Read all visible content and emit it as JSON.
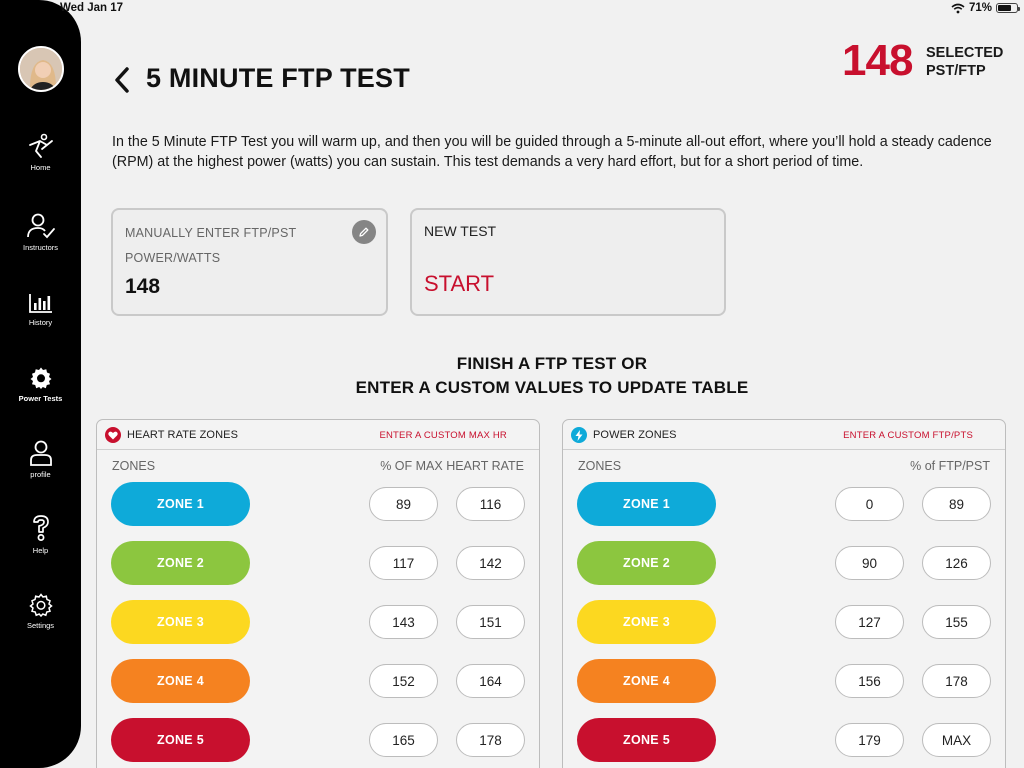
{
  "status_bar": {
    "time": "Wed Jan 17",
    "battery": "71%",
    "battery_level": 0.71
  },
  "sidebar": {
    "items": [
      {
        "label": "Home",
        "icon": "rider-icon"
      },
      {
        "label": "Instructors",
        "icon": "instructor-icon"
      },
      {
        "label": "History",
        "icon": "chart-icon"
      },
      {
        "label": "Power Tests",
        "icon": "gear-icon"
      },
      {
        "label": "profile",
        "icon": "person-icon"
      },
      {
        "label": "Help",
        "icon": "question-icon"
      },
      {
        "label": "Settings",
        "icon": "settings-icon"
      }
    ]
  },
  "header": {
    "title": "5 MINUTE FTP TEST",
    "selected_value": "148",
    "selected_label_1": "SELECTED",
    "selected_label_2": "PST/FTP"
  },
  "description": "In the 5 Minute FTP Test you will warm up, and then you will be guided through a 5-minute all-out effort, where you’ll hold a steady cadence (RPM) at the highest power (watts) you can sustain. This test demands a very hard effort, but for a short period of time.",
  "manual_card": {
    "label_1": "MANUALLY ENTER FTP/PST",
    "label_2": "POWER/WATTS",
    "value": "148"
  },
  "new_test_card": {
    "label": "NEW TEST",
    "start": "START"
  },
  "finish_text_1": "FINISH A FTP TEST OR",
  "finish_text_2": "ENTER A CUSTOM VALUES TO UPDATE TABLE",
  "colors": {
    "accent": "#c8102e",
    "zone1": "#0eaad9",
    "zone2": "#8cc63f",
    "zone3": "#fcd820",
    "zone4": "#f58220",
    "zone5": "#c8102e"
  },
  "heart_rate": {
    "title": "HEART RATE ZONES",
    "link": "ENTER A CUSTOM MAX HR",
    "col_zones": "ZONES",
    "col_values": "% OF MAX HEART RATE",
    "zones": [
      {
        "name": "ZONE 1",
        "min": "89",
        "max": "116"
      },
      {
        "name": "ZONE 2",
        "min": "117",
        "max": "142"
      },
      {
        "name": "ZONE 3",
        "min": "143",
        "max": "151"
      },
      {
        "name": "ZONE 4",
        "min": "152",
        "max": "164"
      },
      {
        "name": "ZONE 5",
        "min": "165",
        "max": "178"
      }
    ]
  },
  "power": {
    "title": "POWER ZONES",
    "link": "ENTER A CUSTOM FTP/PTS",
    "col_zones": "ZONES",
    "col_values": "% of FTP/PST",
    "zones": [
      {
        "name": "ZONE 1",
        "min": "0",
        "max": "89"
      },
      {
        "name": "ZONE 2",
        "min": "90",
        "max": "126"
      },
      {
        "name": "ZONE 3",
        "min": "127",
        "max": "155"
      },
      {
        "name": "ZONE 4",
        "min": "156",
        "max": "178"
      },
      {
        "name": "ZONE 5",
        "min": "179",
        "max": "MAX"
      }
    ]
  }
}
